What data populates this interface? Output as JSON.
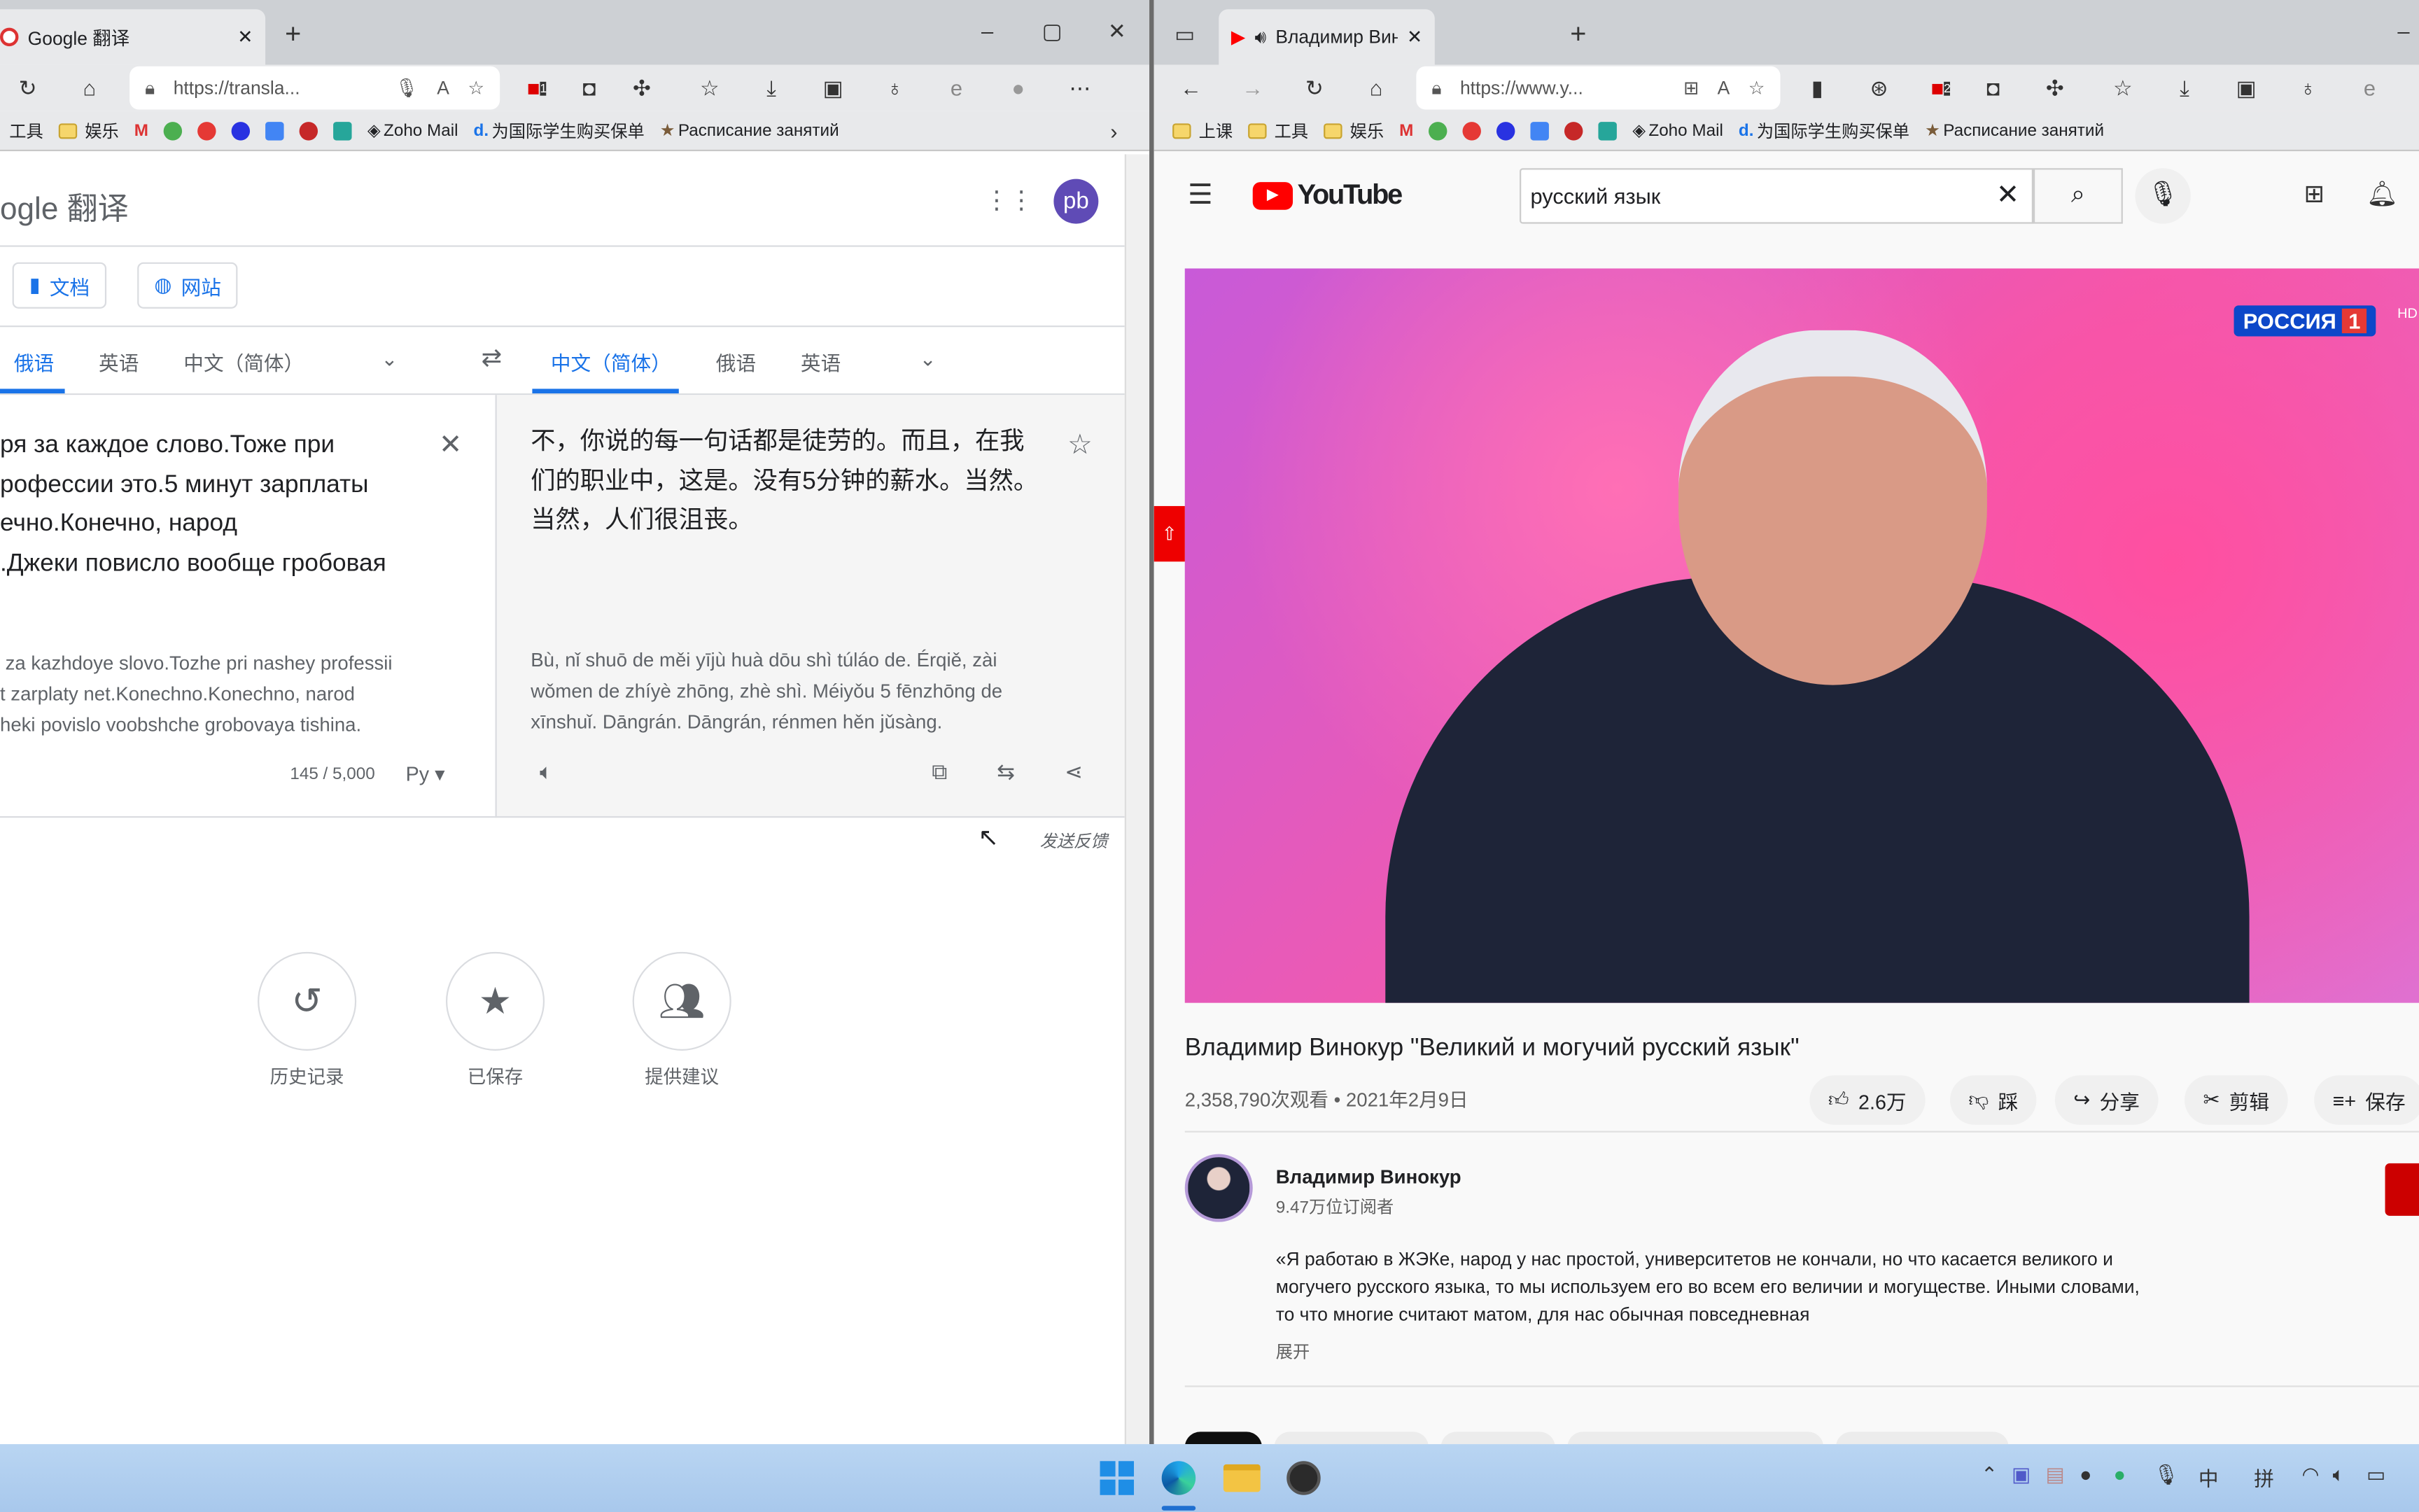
{
  "left_window": {
    "tab_title": "Google 翻译",
    "url": "https://transla...",
    "extension_badge": "1",
    "bookmarks": [
      "工具",
      "娱乐",
      "Zoho Mail",
      "为国际学生购买保单",
      "Расписание занятий"
    ],
    "page": {
      "logo": "ogle 翻译",
      "avatar": "pb",
      "mode_buttons": [
        "文档",
        "网站"
      ],
      "source_langs": [
        "俄语",
        "英语",
        "中文（简体）"
      ],
      "target_langs": [
        "中文（简体）",
        "俄语",
        "英语"
      ],
      "source_text": "ря за каждое слово.Тоже при\nрофессии это.5 минут зарплаты\nечно.Конечно, народ\n.Джеки повисло вообще гробовая",
      "source_translit": " za kazhdoye slovo.Tozhe pri nashey professii\nt zarplaty net.Konechno.Konechno, narod\nheki povislo voobshche grobovaya tishina.",
      "char_count": "145 / 5,000",
      "input_tool": "Pу",
      "target_text": "不，你说的每一句话都是徒劳的。而且，在我们的职业中，这是。没有5分钟的薪水。当然。当然，人们很沮丧。",
      "target_pinyin": "Bù, nǐ shuō de měi yījù huà dōu shì túláo de. Érqiě, zài wǒmen de zhíyè zhōng, zhè shì. Méiyǒu 5 fēnzhōng de xīnshuǐ. Dāngrán. Dāngrán, rénmen hěn jǔsàng.",
      "feedback": "发送反馈",
      "actions": [
        {
          "label": "历史记录",
          "icon": "history-icon"
        },
        {
          "label": "已保存",
          "icon": "star-icon"
        },
        {
          "label": "提供建议",
          "icon": "people-icon"
        }
      ]
    }
  },
  "right_window": {
    "tab_title": "Владимир Винокур \"Велик",
    "url": "https://www.y...",
    "extension_badge": "2",
    "bookmarks": [
      "上课",
      "工具",
      "娱乐",
      "Zoho Mail",
      "为国际学生购买保单",
      "Расписание занятий"
    ],
    "youtube": {
      "logo": "YouTube",
      "search_value": "русский язык",
      "channel_logo": "РОССИЯ",
      "channel_num": "1",
      "hd": "HD",
      "title": "Владимир Винокур \"Великий и могучий русский язык\"",
      "stats": "2,358,790次观看 • 2021年2月9日",
      "buttons": {
        "like": "2.6万",
        "dislike": "踩",
        "share": "分享",
        "clip": "剪辑",
        "save": "保存"
      },
      "channel_name": "Владимир Винокур",
      "subscribers": "9.47万位订阅者",
      "description": "«Я работаю в ЖЭКе, народ у нас простой, университетов не кончали, но что касается великого и могучего русского языка, то мы используем его во всем его величии и могуществе. Иными словами, то что многие считают матом, для нас обычная повседневная",
      "expand": "展开"
    }
  },
  "taskbar": {
    "ime_lang": "中",
    "ime_mode": "拼"
  },
  "colors": {
    "google_blue": "#1a73e8",
    "youtube_red": "#ff0000",
    "avatar_purple": "#5f4bb6",
    "taskbar": "#b3d1f0"
  }
}
